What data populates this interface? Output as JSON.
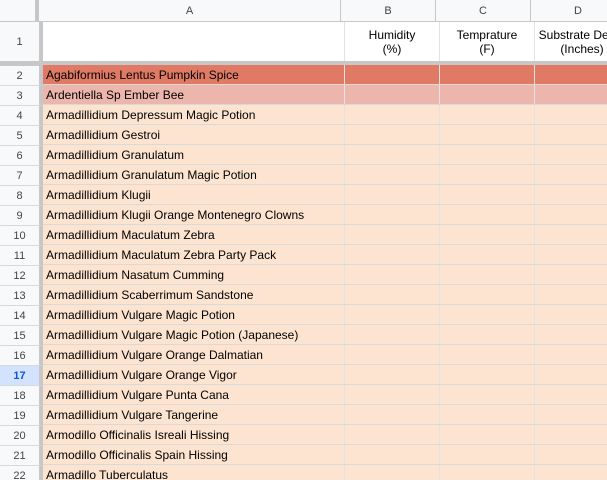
{
  "columns": [
    {
      "letter": "A",
      "width": 302
    },
    {
      "letter": "B",
      "width": 95
    },
    {
      "letter": "C",
      "width": 95
    },
    {
      "letter": "D",
      "width": 95
    }
  ],
  "header_row": {
    "number": "1",
    "cells": [
      "",
      "Humidity\n(%)",
      "Temprature\n(F)",
      "Substrate Depth\n(Inches)"
    ]
  },
  "colors": {
    "row_highlight_dark": "#e07a65",
    "row_highlight_light": "#edb6ad",
    "row_fill": "#fce4d0"
  },
  "active_row": "17",
  "rows": [
    {
      "number": "2",
      "name": "Agabiformius Lentus Pumpkin Spice",
      "fill": "dark"
    },
    {
      "number": "3",
      "name": "Ardentiella Sp Ember Bee",
      "fill": "light"
    },
    {
      "number": "4",
      "name": "Armadillidium Depressum Magic Potion",
      "fill": "base"
    },
    {
      "number": "5",
      "name": "Armadillidium Gestroi",
      "fill": "base"
    },
    {
      "number": "6",
      "name": "Armadillidium Granulatum",
      "fill": "base"
    },
    {
      "number": "7",
      "name": "Armadillidium Granulatum Magic Potion",
      "fill": "base"
    },
    {
      "number": "8",
      "name": "Armadillidium Klugii",
      "fill": "base"
    },
    {
      "number": "9",
      "name": "Armadillidium Klugii Orange Montenegro Clowns",
      "fill": "base"
    },
    {
      "number": "10",
      "name": "Armadillidium Maculatum Zebra",
      "fill": "base"
    },
    {
      "number": "11",
      "name": "Armadillidium Maculatum Zebra Party Pack",
      "fill": "base"
    },
    {
      "number": "12",
      "name": "Armadillidium Nasatum Cumming",
      "fill": "base"
    },
    {
      "number": "13",
      "name": "Armadillidium Scaberrimum Sandstone",
      "fill": "base"
    },
    {
      "number": "14",
      "name": "Armadillidium Vulgare Magic Potion",
      "fill": "base"
    },
    {
      "number": "15",
      "name": "Armadillidium Vulgare Magic Potion (Japanese)",
      "fill": "base"
    },
    {
      "number": "16",
      "name": "Armadillidium Vulgare Orange Dalmatian",
      "fill": "base"
    },
    {
      "number": "17",
      "name": "Armadillidium Vulgare Orange Vigor",
      "fill": "base"
    },
    {
      "number": "18",
      "name": "Armadillidium Vulgare Punta Cana",
      "fill": "base"
    },
    {
      "number": "19",
      "name": "Armadillidium Vulgare Tangerine",
      "fill": "base"
    },
    {
      "number": "20",
      "name": "Armodillo Officinalis Isreali Hissing",
      "fill": "base"
    },
    {
      "number": "21",
      "name": "Armodillo Officinalis Spain Hissing",
      "fill": "base"
    },
    {
      "number": "22",
      "name": "Armadillo Tuberculatus",
      "fill": "base"
    }
  ]
}
